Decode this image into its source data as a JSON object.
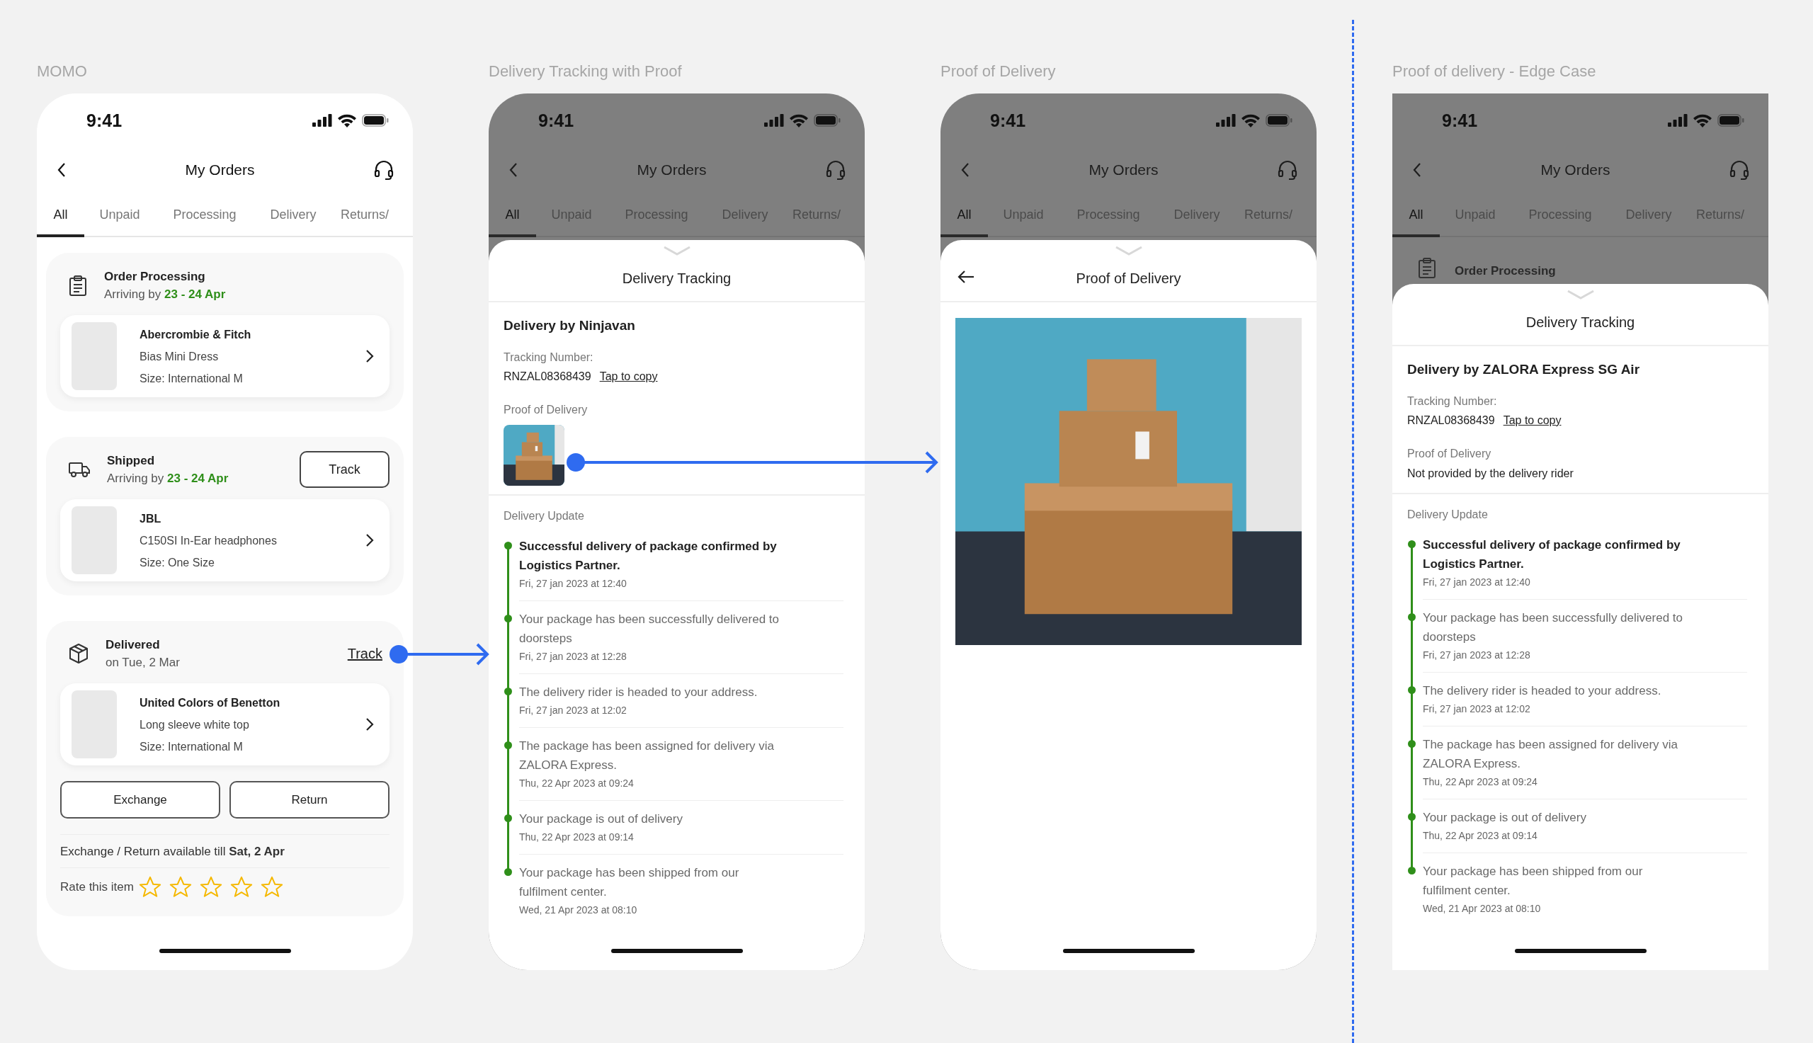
{
  "screens": [
    {
      "kind": "orders",
      "label": "MOMO",
      "time": "9:41",
      "title": "My Orders",
      "tabs": [
        {
          "label": "All",
          "selected": true
        },
        {
          "label": "Unpaid",
          "selected": false
        },
        {
          "label": "Processing",
          "selected": false
        },
        {
          "label": "Delivery",
          "selected": false
        },
        {
          "label": "Returns/",
          "selected": false
        }
      ],
      "orders": [
        {
          "kind": "processing",
          "status": "Order Processing",
          "sub": "Arriving by **23 - 24 Apr**",
          "product": {
            "brand": "Abercrombie & Fitch",
            "name": "Bias Mini Dress",
            "size": "Size: International M"
          }
        },
        {
          "kind": "shipped",
          "status": "Shipped",
          "sub": "Arriving by **23 - 24 Apr**",
          "track": {
            "label": "Track",
            "kind": "button"
          },
          "product": {
            "brand": "JBL",
            "name": "C150SI In-Ear headphones",
            "size": "Size: One Size"
          }
        },
        {
          "kind": "delivered",
          "status": "Delivered",
          "sub": "on Tue, 2 Mar",
          "track": {
            "label": "Track",
            "kind": "link"
          },
          "product": {
            "brand": "United Colors of Benetton",
            "name": "Long sleeve white top",
            "size": "Size: International M"
          },
          "actions": [
            "Exchange",
            "Return"
          ],
          "note": "Exchange / Return available till **Sat, 2 Apr**",
          "rating": {
            "label": "Rate this item",
            "stars": 0
          }
        }
      ]
    },
    {
      "kind": "tracking",
      "label": "Delivery Tracking with Proof",
      "time": "9:41",
      "title": "My Orders",
      "tabs": [
        {
          "label": "All",
          "selected": true
        },
        {
          "label": "Unpaid",
          "selected": false
        },
        {
          "label": "Processing",
          "selected": false
        },
        {
          "label": "Delivery",
          "selected": false
        },
        {
          "label": "Returns/",
          "selected": false
        }
      ],
      "sheet": {
        "title": "Delivery Tracking",
        "carrier": "Delivery by Ninjavan",
        "tracking_label": "Tracking Number:",
        "tracking_number": "RNZAL08368439",
        "copy_link": "Tap to copy",
        "proof_label": "Proof of Delivery",
        "proof": {
          "kind": "photo"
        },
        "updates_label": "Delivery Update",
        "updates": [
          {
            "text": "Successful delivery of package confirmed by Logistics Partner.",
            "date": "Fri, 27 jan 2023 at 12:40",
            "highlighted": true
          },
          {
            "text": "Your package has been successfully delivered to doorsteps",
            "date": "Fri, 27 jan 2023 at 12:28",
            "highlighted": false
          },
          {
            "text": "The delivery rider is headed to your address.",
            "date": "Fri, 27 jan 2023 at 12:02",
            "highlighted": false
          },
          {
            "text": "The package has been assigned for delivery via ZALORA Express.",
            "date": "Thu, 22 Apr 2023 at 09:24",
            "highlighted": false
          },
          {
            "text": "Your package is out of delivery",
            "date": "Thu, 22 Apr 2023 at 09:14",
            "highlighted": false
          },
          {
            "text": "Your package has been shipped from our fulfilment center.",
            "date": "Wed, 21 Apr 2023 at 08:10",
            "highlighted": false
          }
        ]
      }
    },
    {
      "kind": "proof",
      "label": "Proof of Delivery",
      "time": "9:41",
      "title": "My Orders",
      "tabs": [
        {
          "label": "All",
          "selected": true
        },
        {
          "label": "Unpaid",
          "selected": false
        },
        {
          "label": "Processing",
          "selected": false
        },
        {
          "label": "Delivery",
          "selected": false
        },
        {
          "label": "Returns/",
          "selected": false
        }
      ],
      "sheet": {
        "title": "Proof of Delivery"
      }
    },
    {
      "kind": "tracking",
      "label": "Proof of delivery - Edge Case",
      "time": "9:41",
      "title": "My Orders",
      "tabs": [
        {
          "label": "All",
          "selected": true
        },
        {
          "label": "Unpaid",
          "selected": false
        },
        {
          "label": "Processing",
          "selected": false
        },
        {
          "label": "Delivery",
          "selected": false
        },
        {
          "label": "Returns/",
          "selected": false
        }
      ],
      "peek": "Order Processing",
      "sheet": {
        "title": "Delivery Tracking",
        "carrier": "Delivery by ZALORA Express SG Air",
        "tracking_label": "Tracking Number:",
        "tracking_number": "RNZAL08368439",
        "copy_link": "Tap to copy",
        "proof_label": "Proof of Delivery",
        "proof": {
          "kind": "note",
          "text": "Not provided by the delivery rider"
        },
        "updates_label": "Delivery Update",
        "updates": [
          {
            "text": "Successful delivery of package confirmed by Logistics Partner.",
            "date": "Fri, 27 jan 2023 at 12:40",
            "highlighted": true
          },
          {
            "text": "Your package has been successfully delivered to doorsteps",
            "date": "Fri, 27 jan 2023 at 12:28",
            "highlighted": false
          },
          {
            "text": "The delivery rider is headed to your address.",
            "date": "Fri, 27 jan 2023 at 12:02",
            "highlighted": false
          },
          {
            "text": "The package has been assigned for delivery via ZALORA Express.",
            "date": "Thu, 22 Apr 2023 at 09:24",
            "highlighted": false
          },
          {
            "text": "Your package is out of delivery",
            "date": "Thu, 22 Apr 2023 at 09:14",
            "highlighted": false
          },
          {
            "text": "Your package has been shipped from our fulfilment center.",
            "date": "Wed, 21 Apr 2023 at 08:10",
            "highlighted": false
          }
        ]
      }
    }
  ]
}
